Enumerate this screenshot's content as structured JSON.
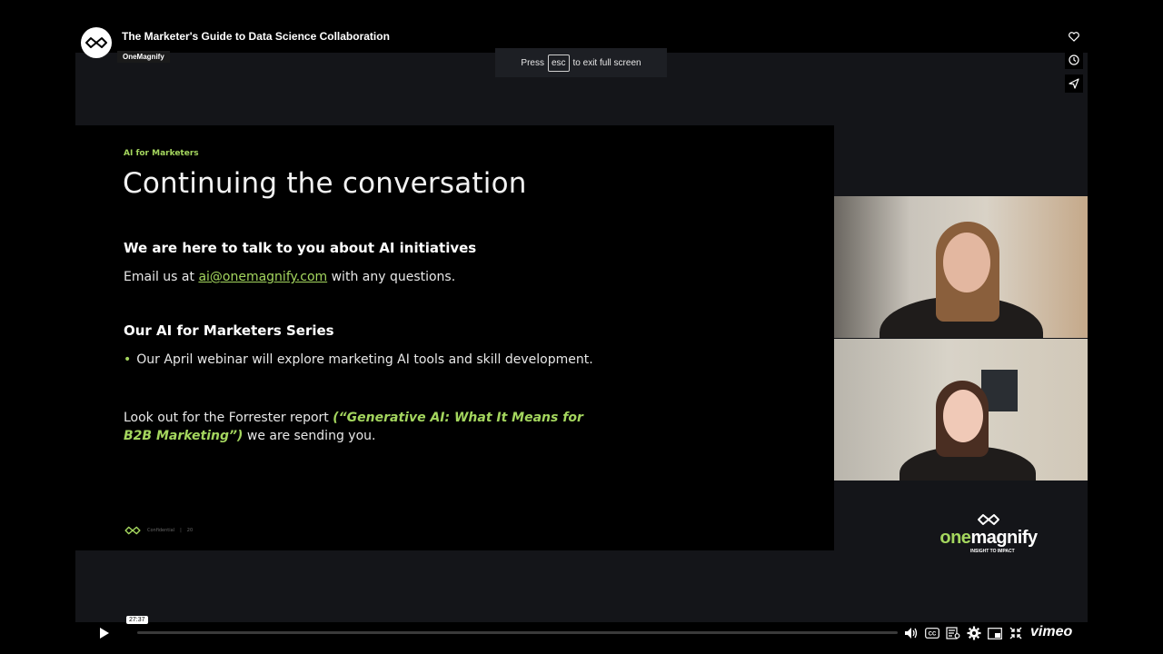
{
  "player": {
    "title": "The Marketer's Guide to Data Science Collaboration",
    "byline": "OneMagnify",
    "esc_prefix": "Press",
    "esc_key": "esc",
    "esc_suffix": "to exit full screen",
    "current_time": "27:37",
    "progress_fraction": 0.0,
    "vimeo_label": "vimeo",
    "icons": {
      "like": "heart-icon",
      "watch_later": "clock-icon",
      "share": "send-icon",
      "play": "play-icon",
      "volume": "volume-icon",
      "captions": "cc-icon",
      "transcript": "transcript-icon",
      "settings": "gear-icon",
      "pip": "pip-icon",
      "fullscreen": "exit-fullscreen-icon"
    }
  },
  "slide": {
    "kicker": "AI for Marketers",
    "headline": "Continuing the conversation",
    "section1_heading": "We are here to talk to you about AI initiatives",
    "section1_prefix": "Email us at",
    "section1_email": "ai@onemagnify.com",
    "section1_suffix": "with any questions.",
    "section2_heading": "Our AI for Marketers Series",
    "bullet": "Our April webinar will explore marketing AI tools and skill development.",
    "forrester_prefix": "Look out for the Forrester report",
    "forrester_title": "(“Generative AI: What It Means for B2B Marketing”)",
    "forrester_suffix": "we are sending you.",
    "footer_label": "Confidential",
    "footer_page": "20"
  },
  "brand": {
    "one": "one",
    "magnify": "magnify",
    "tagline": "INSIGHT TO IMPACT"
  },
  "colors": {
    "accent_green": "#a4d65e",
    "background": "#000000",
    "stage": "#141519"
  }
}
